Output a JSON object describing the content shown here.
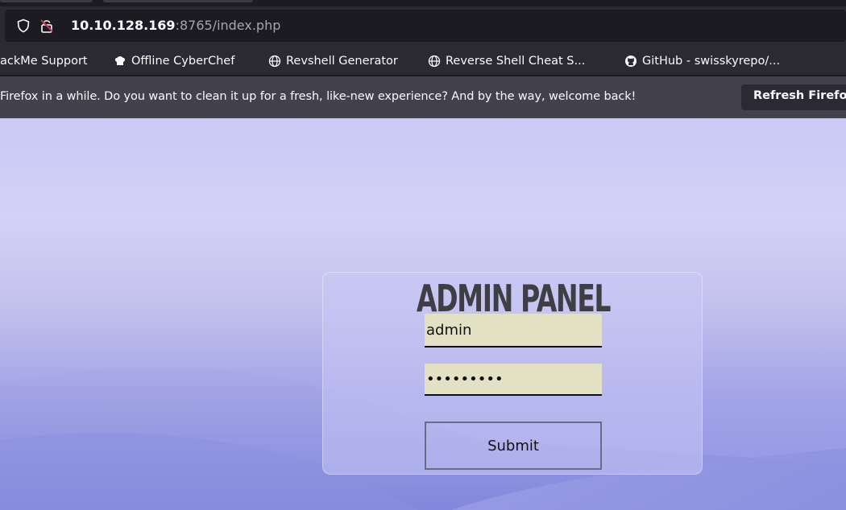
{
  "browser": {
    "url_host": "10.10.128.169",
    "url_rest": ":8765/index.php",
    "bookmarks": [
      {
        "label": "ackMe Support",
        "icon": "none"
      },
      {
        "label": "Offline CyberChef",
        "icon": "chef-hat-icon"
      },
      {
        "label": "Revshell Generator",
        "icon": "globe-icon"
      },
      {
        "label": "Reverse Shell Cheat S...",
        "icon": "globe-icon"
      },
      {
        "label": "GitHub - swisskyrepo/...",
        "icon": "github-icon"
      }
    ],
    "notification": {
      "message": "Firefox in a while. Do you want to clean it up for a fresh, like-new experience? And by the way, welcome back!",
      "button_label": "Refresh Firefox"
    }
  },
  "login": {
    "title": "ADMIN PANEL",
    "username_value": "admin",
    "password_value": "•••••••••",
    "submit_label": "Submit"
  },
  "colors": {
    "chrome_dark": "#1c1b22",
    "chrome": "#2b2a33",
    "notice": "#42414d",
    "field_bg": "#e2e1c3",
    "title": "#403e45"
  }
}
